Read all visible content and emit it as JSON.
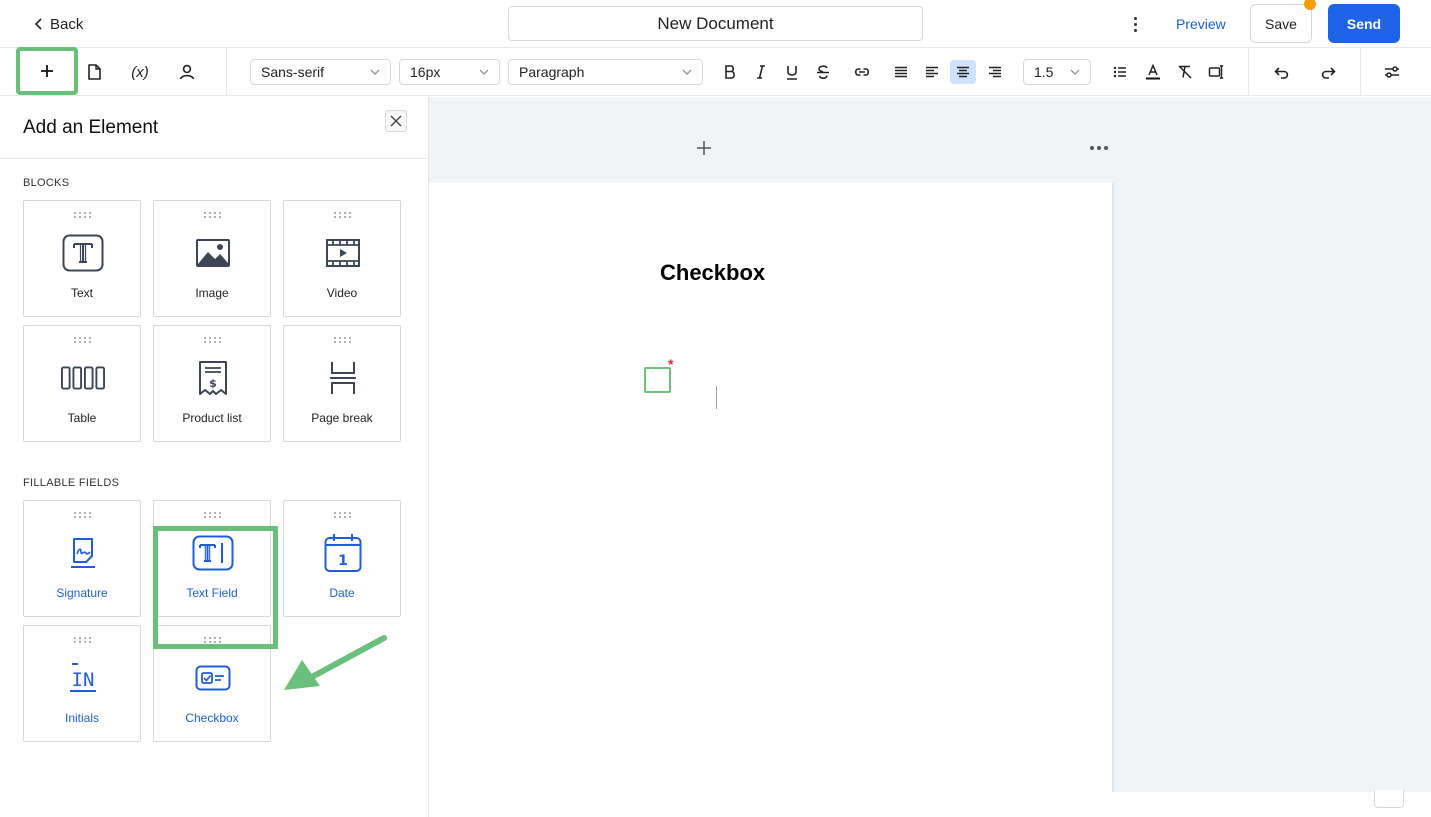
{
  "header": {
    "back_label": "Back",
    "document_title": "New Document",
    "preview_label": "Preview",
    "save_label": "Save",
    "send_label": "Send"
  },
  "toolbar": {
    "tools": [
      "add-element",
      "document",
      "variables",
      "recipient"
    ],
    "variables_label": "(x)",
    "font_family": "Sans-serif",
    "font_size": "16px",
    "block_style": "Paragraph",
    "line_height": "1.5",
    "active_alignment": "center"
  },
  "sidebar": {
    "title": "Add an Element",
    "blocks_label": "BLOCKS",
    "blocks": [
      {
        "label": "Text",
        "icon": "text-block-icon"
      },
      {
        "label": "Image",
        "icon": "image-icon"
      },
      {
        "label": "Video",
        "icon": "video-icon"
      },
      {
        "label": "Table",
        "icon": "table-icon"
      },
      {
        "label": "Product list",
        "icon": "product-list-icon"
      },
      {
        "label": "Page break",
        "icon": "page-break-icon"
      }
    ],
    "fields_label": "FILLABLE FIELDS",
    "fields": [
      {
        "label": "Signature",
        "icon": "signature-icon"
      },
      {
        "label": "Text Field",
        "icon": "text-field-icon"
      },
      {
        "label": "Date",
        "icon": "calendar-icon"
      },
      {
        "label": "Initials",
        "icon": "initials-icon"
      },
      {
        "label": "Checkbox",
        "icon": "checkbox-icon"
      }
    ],
    "date_icon_number": "1",
    "initials_icon_text": "IN"
  },
  "document": {
    "heading": "Checkbox",
    "required_marker": "*"
  },
  "colors": {
    "accent": "#1f64e8",
    "highlight": "#6abf7b",
    "required": "#e02424",
    "notification": "#f59e0b"
  }
}
